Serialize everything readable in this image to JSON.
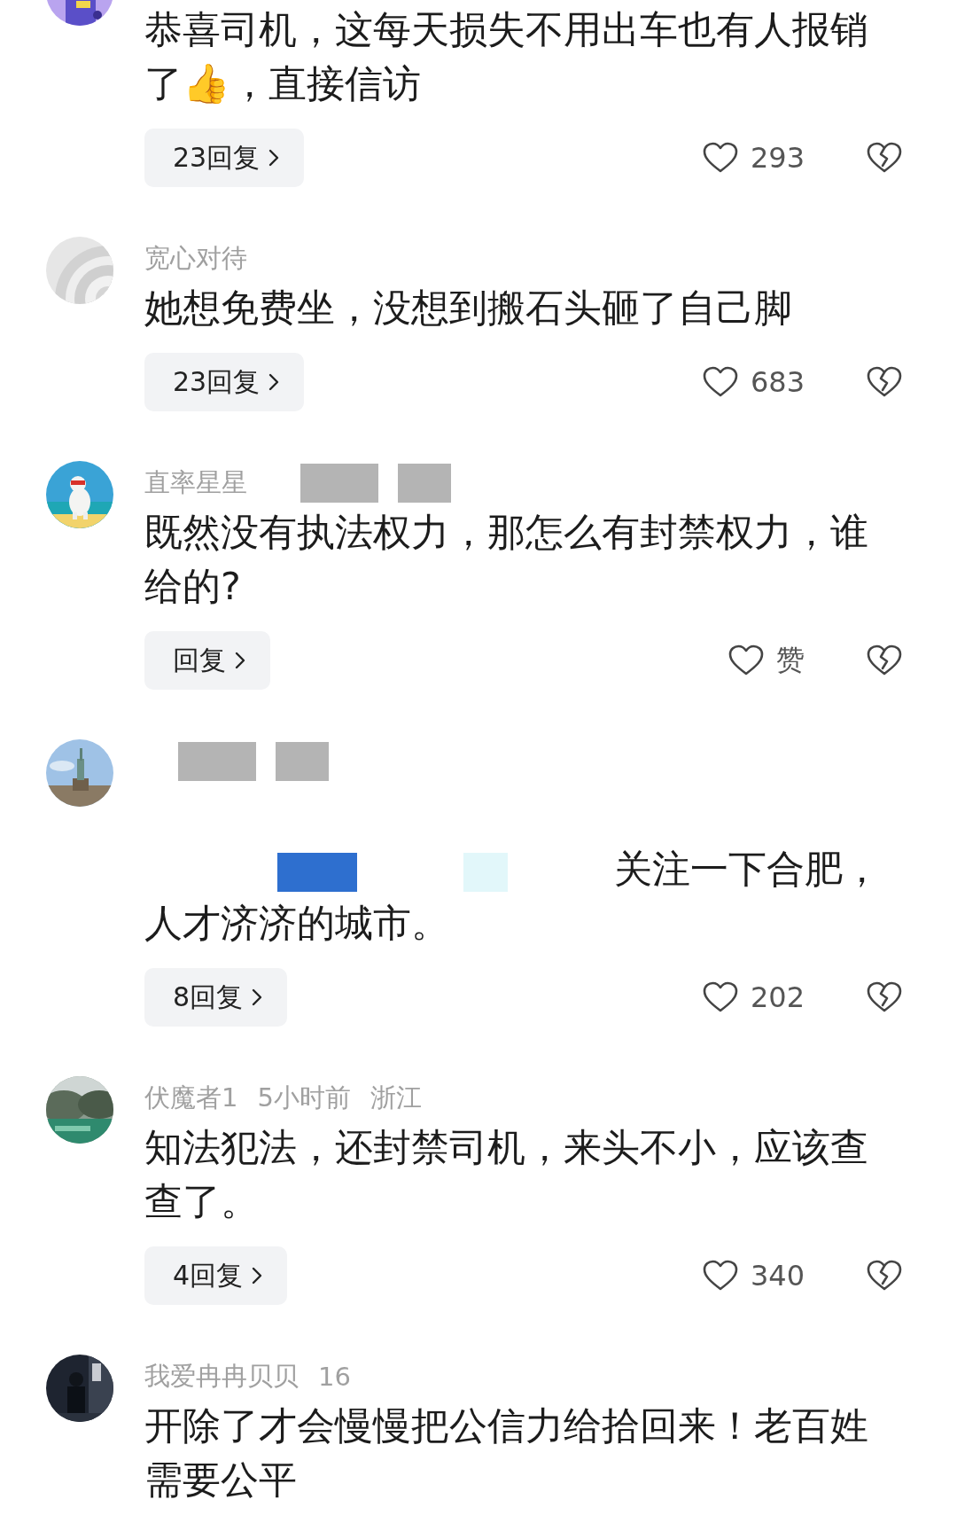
{
  "comments": [
    {
      "redacted_line": false,
      "body": "恭喜司机，这每天损失不用出车也有人报销了👍，直接信访",
      "replies": "23回复",
      "likes": "293"
    },
    {
      "redacted_meta": false,
      "redacted_line": false,
      "name": "宽心对待",
      "body": "她想免费坐，没想到搬石头砸了自己脚",
      "replies": "23回复",
      "likes": "683"
    },
    {
      "redacted_meta": true,
      "redacted_line": false,
      "name": "直率星星",
      "body": "既然没有执法权力，那怎么有封禁权力，谁给的?",
      "replies": "回复",
      "likes": "赞"
    },
    {
      "redacted_meta": true,
      "redacted_line": true,
      "body": "关注一下合肥，人才济济的城市。",
      "replies": "8回复",
      "likes": "202"
    },
    {
      "redacted_meta": false,
      "redacted_line": false,
      "name": "伏魔者1",
      "time": "5小时前",
      "place": "浙江",
      "body": "知法犯法，还封禁司机，来头不小，应该查查了。",
      "replies": "4回复",
      "likes": "340"
    },
    {
      "redacted_meta": false,
      "redacted_line": false,
      "name": "我爱冉冉贝贝",
      "time": "16",
      "body": "开除了才会慢慢把公信力给拾回来！老百姓需要公平"
    }
  ]
}
